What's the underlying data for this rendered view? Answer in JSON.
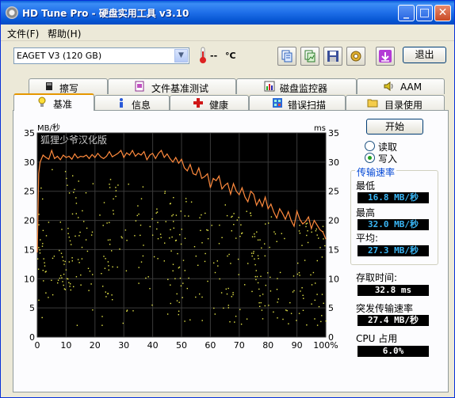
{
  "window": {
    "title": "HD Tune Pro - 硬盘实用工具 v3.10",
    "controls": [
      "_",
      "□",
      "✕"
    ]
  },
  "menu": [
    "文件(F)",
    "帮助(H)"
  ],
  "toolbar": {
    "drive": "EAGET   V3 (120 GB)",
    "temp_value": "--",
    "temp_unit": "°C",
    "exit_label": "退出",
    "tools": [
      "copy-info-icon",
      "copy-screenshot-icon",
      "save-icon",
      "options-icon",
      "download-icon"
    ]
  },
  "tabs": {
    "row1": [
      "擦写",
      "文件基准测试",
      "磁盘监控器",
      "AAM"
    ],
    "row2": [
      "基准",
      "信息",
      "健康",
      "错误扫描",
      "目录使用"
    ],
    "selected": "基准"
  },
  "side": {
    "start_label": "开始",
    "read_label": "读取",
    "write_label": "写入",
    "mode_selected": "写入",
    "transfer_title": "传输速率",
    "min_label": "最低",
    "min_value": "16.8 MB/秒",
    "max_label": "最高",
    "max_value": "32.0 MB/秒",
    "avg_label": "平均:",
    "avg_value": "27.3 MB/秒",
    "access_label": "存取时间:",
    "access_value": "32.8 ms",
    "burst_label": "突发传输速率",
    "burst_value": "27.4 MB/秒",
    "cpu_label": "CPU 占用",
    "cpu_value": "6.0%"
  },
  "colors": {
    "plot_bg": "#000000",
    "grid": "#3a3a3a",
    "transfer_line": "#ff8a3d",
    "access_points": "#e8e84a",
    "accent": "#0046d5"
  },
  "chart_data": {
    "type": "line",
    "watermark": "狐狸少爷汉化版",
    "ylabel_left": "MB/秒",
    "ylabel_right": "ms",
    "x_ticks": [
      "0",
      "10",
      "20",
      "30",
      "40",
      "50",
      "60",
      "70",
      "80",
      "90",
      "100%"
    ],
    "y_ticks": [
      "0",
      "5",
      "10",
      "15",
      "20",
      "25",
      "30",
      "35"
    ],
    "xlim": [
      0,
      100
    ],
    "ylim": [
      0,
      35
    ],
    "grid": true,
    "series": [
      {
        "x": [
          0,
          0.5,
          1,
          2,
          3,
          4,
          5,
          6,
          7,
          8,
          9,
          10,
          11,
          12,
          13,
          14,
          15,
          16,
          17,
          18,
          19,
          20,
          21,
          22,
          23,
          24,
          25,
          26,
          27,
          28,
          29,
          30,
          31,
          32,
          33,
          34,
          35,
          36,
          37,
          38,
          39,
          40,
          41,
          42,
          43,
          44,
          45,
          46,
          47,
          48,
          49,
          50,
          51,
          52,
          53,
          54,
          55,
          56,
          57,
          58,
          59,
          60,
          61,
          62,
          63,
          64,
          65,
          66,
          67,
          68,
          69,
          70,
          71,
          72,
          73,
          74,
          75,
          76,
          77,
          78,
          79,
          80,
          81,
          82,
          83,
          84,
          85,
          86,
          87,
          88,
          89,
          90,
          91,
          92,
          93,
          94,
          95,
          96,
          97,
          98,
          99,
          100
        ],
        "values": [
          14.5,
          28.0,
          30.0,
          31.2,
          30.8,
          30.5,
          32.0,
          30.6,
          31.0,
          30.4,
          31.2,
          30.8,
          31.0,
          30.5,
          31.4,
          30.7,
          31.0,
          30.9,
          31.2,
          30.6,
          31.3,
          30.8,
          31.5,
          30.9,
          30.6,
          31.0,
          31.8,
          30.9,
          31.2,
          31.5,
          32.0,
          30.8,
          31.6,
          31.2,
          32.0,
          31.0,
          31.5,
          31.2,
          31.8,
          30.4,
          31.2,
          31.5,
          30.6,
          31.5,
          32.0,
          30.8,
          31.4,
          30.6,
          30.0,
          30.8,
          29.8,
          30.5,
          29.0,
          28.5,
          29.6,
          28.0,
          27.8,
          29.0,
          27.2,
          27.5,
          28.0,
          25.6,
          27.2,
          26.8,
          27.6,
          25.4,
          26.0,
          26.4,
          24.5,
          26.3,
          25.0,
          24.4,
          25.6,
          24.0,
          23.2,
          25.0,
          24.5,
          22.6,
          23.6,
          22.4,
          24.0,
          22.0,
          22.8,
          21.4,
          20.4,
          22.0,
          21.2,
          20.2,
          21.5,
          20.0,
          19.0,
          21.6,
          20.2,
          19.4,
          19.8,
          20.6,
          18.6,
          20.0,
          19.2,
          18.4,
          18.0,
          16.8
        ]
      }
    ],
    "scatter_note": "access time points, right axis (ms)"
  }
}
